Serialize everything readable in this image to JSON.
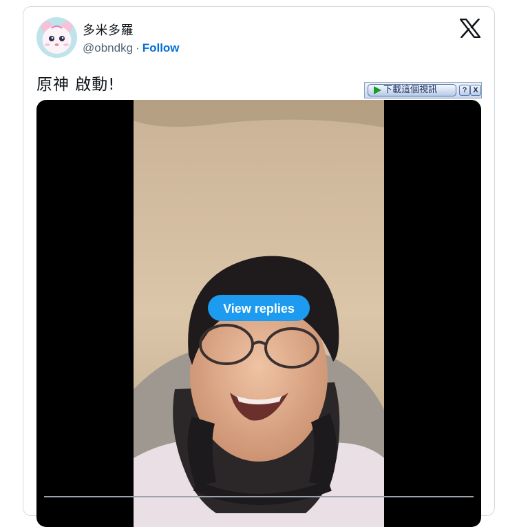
{
  "tweet": {
    "display_name": "多米多羅",
    "handle": "@obndkg",
    "separator": "·",
    "follow_label": "Follow",
    "text": "原神 啟動!"
  },
  "brand": {
    "logo_icon": "x-logo-icon"
  },
  "download_bar": {
    "label": "下載這個視訊",
    "help_label": "?",
    "close_label": "X",
    "play_icon": "play-icon"
  },
  "video": {
    "view_replies_label": "View replies",
    "accent_color": "#1d9bf0"
  },
  "colors": {
    "follow_link": "#006fd6",
    "secondary_text": "#536471",
    "primary_text": "#0f1419"
  }
}
